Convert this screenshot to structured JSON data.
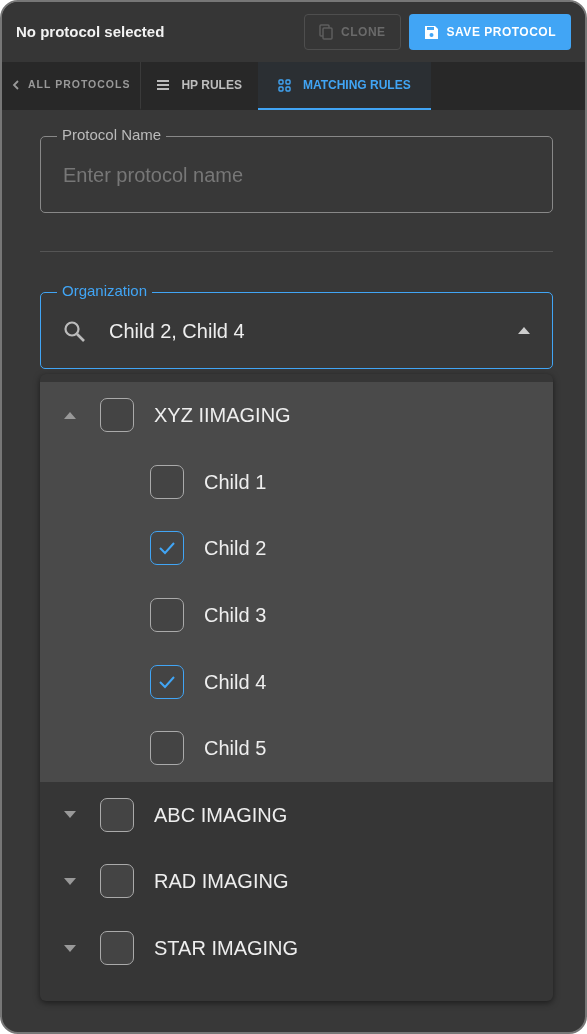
{
  "header": {
    "title": "No protocol selected",
    "buttons": [
      {
        "label": "CLONE",
        "kind": "clone",
        "disabled": true
      },
      {
        "label": "SAVE PROTOCOL",
        "kind": "save",
        "disabled": false
      }
    ]
  },
  "tabs": [
    {
      "label": "ALL PROTOCOLS",
      "kind": "back",
      "selected": false
    },
    {
      "label": "HP RULES",
      "kind": "list",
      "selected": false
    },
    {
      "label": "MATCHING RULES",
      "kind": "grid",
      "selected": true
    }
  ],
  "protocol_name": {
    "label": "Protocol Name",
    "placeholder": "Enter protocol name"
  },
  "organization": {
    "label": "Organization",
    "value": "Child 2, Child 4",
    "expanded": true
  },
  "tree": [
    {
      "label": "XYZ IIMAGING",
      "expanded": true,
      "checked": false,
      "children": [
        {
          "label": "Child 1",
          "checked": false
        },
        {
          "label": "Child 2",
          "checked": true
        },
        {
          "label": "Child 3",
          "checked": false
        },
        {
          "label": "Child 4",
          "checked": true
        },
        {
          "label": "Child 5",
          "checked": false
        }
      ]
    },
    {
      "label": "ABC IMAGING",
      "expanded": false,
      "checked": false
    },
    {
      "label": "RAD IMAGING",
      "expanded": false,
      "checked": false
    },
    {
      "label": "STAR IMAGING",
      "expanded": false,
      "checked": false
    }
  ]
}
